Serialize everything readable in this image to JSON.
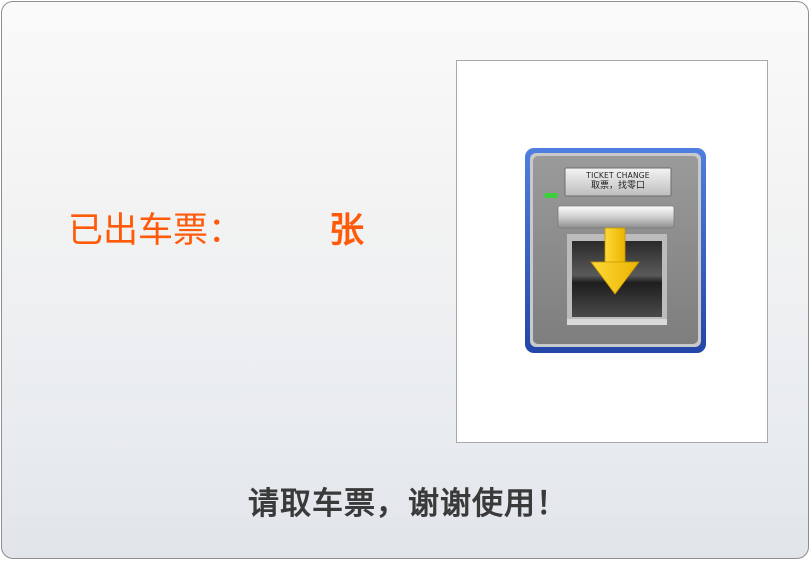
{
  "status": {
    "issued_label": "已出车票：",
    "issued_count": "",
    "issued_unit": "张",
    "label_color": "#ff5a0a"
  },
  "illustration": {
    "icon": "ticket-change-machine-icon",
    "sign_line1": "TICKET CHANGE",
    "sign_line2": "取票，找零口",
    "arrow_icon": "arrow-down-icon",
    "frame_color": "#2e5fc4",
    "arrow_color": "#f5c400",
    "indicator_color": "#3ccf3c"
  },
  "footer": {
    "message": "请取车票，谢谢使用！"
  }
}
